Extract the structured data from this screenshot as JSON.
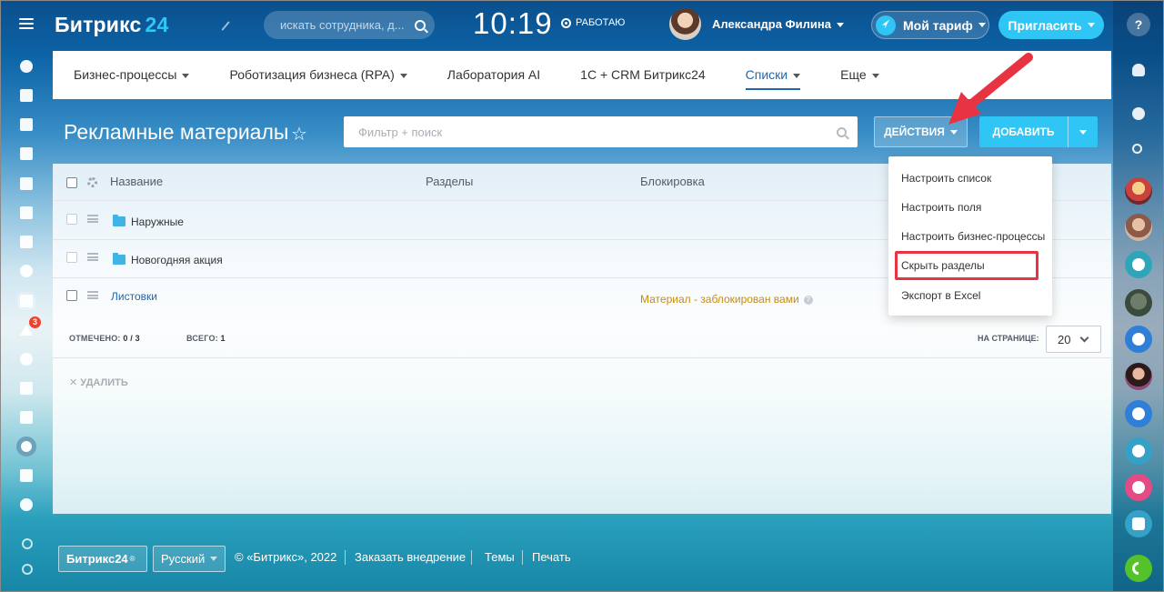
{
  "header": {
    "logo_text": "Битрикс",
    "logo_num": "24",
    "search_placeholder": "искать сотрудника, д...",
    "clock": "10:19",
    "work_status": "РАБОТАЮ",
    "user_name": "Александра Филина",
    "tariff_label": "Мой тариф",
    "invite_label": "Пригласить"
  },
  "left_nav": {
    "badge_count": "3",
    "icons": [
      "activity-icon",
      "news-feed-icon",
      "chat-icon",
      "calendar-icon",
      "documents-icon",
      "drive-icon",
      "mail-icon",
      "employees-icon",
      "tasks-icon",
      "crm-icon",
      "sales-icon",
      "shop-icon",
      "contacts-icon",
      "robot-icon",
      "market-icon",
      "more-icon"
    ]
  },
  "top_nav": {
    "items": [
      {
        "label": "Бизнес-процессы",
        "caret": true
      },
      {
        "label": "Роботизация бизнеса (RPA)",
        "caret": true
      },
      {
        "label": "Лаборатория AI",
        "caret": false
      },
      {
        "label": "1С + CRM Битрикс24",
        "caret": false
      },
      {
        "label": "Списки",
        "caret": true,
        "active": true
      },
      {
        "label": "Еще",
        "caret": true
      }
    ]
  },
  "toolbar": {
    "page_title": "Рекламные материалы",
    "filter_placeholder": "Фильтр + поиск",
    "actions_label": "ДЕЙСТВИЯ",
    "add_label": "ДОБАВИТЬ"
  },
  "grid": {
    "columns": [
      "Название",
      "Разделы",
      "Блокировка"
    ],
    "rows": [
      {
        "name": "Наружные",
        "type": "folder",
        "lock": ""
      },
      {
        "name": "Новогодняя акция",
        "type": "folder",
        "lock": ""
      },
      {
        "name": "Листовки",
        "type": "element",
        "lock": "Материал - заблокирован вами"
      }
    ],
    "selected_label": "ОТМЕЧЕНО:",
    "selected_value": "0 / 3",
    "total_label": "ВСЕГО:",
    "total_value": "1",
    "per_page_label": "НА СТРАНИЦЕ:",
    "per_page_value": "20",
    "delete_label": "УДАЛИТЬ"
  },
  "actions_menu": {
    "items": [
      "Настроить список",
      "Настроить поля",
      "Настроить бизнес-процессы",
      "Скрыть разделы",
      "Экспорт в Excel"
    ],
    "highlighted_index": 3
  },
  "footer": {
    "logo": "Битрикс24",
    "language": "Русский",
    "copyright": "© «Битрикс», 2022",
    "order_link": "Заказать внедрение",
    "themes_link": "Темы",
    "print_link": "Печать"
  },
  "colors": {
    "accent": "#2fc6f6",
    "active_link": "#2067b0",
    "annotation_red": "#e83343",
    "lock_text": "#c88a14"
  }
}
